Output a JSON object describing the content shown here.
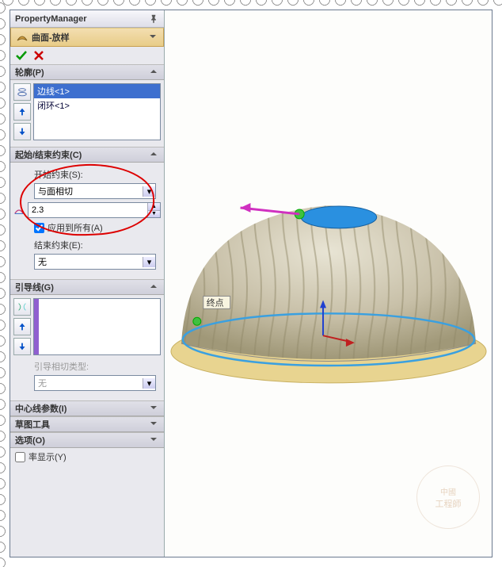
{
  "header": {
    "title": "PropertyManager"
  },
  "feature": {
    "title": "曲面-放样"
  },
  "sections": {
    "profiles": {
      "title": "轮廓(P)",
      "items": [
        "边线<1>",
        "闭环<1>"
      ]
    },
    "constraints": {
      "title": "起始/结束约束(C)",
      "start_label": "开始约束(S):",
      "start_value": "与面相切",
      "tangent_value": "2.3",
      "apply_all": "应用到所有(A)",
      "end_label": "结束约束(E):",
      "end_value": "无"
    },
    "guide": {
      "title": "引导线(G)",
      "tangent_type_label": "引导相切类型:",
      "tangent_type_value": "无"
    },
    "centerline": {
      "title": "中心线参数(I)"
    },
    "sketchtools": {
      "title": "草图工具"
    },
    "options": {
      "title": "选项(O)"
    },
    "curvature": {
      "title": "率显示(Y)"
    }
  },
  "viewport": {
    "callout": "终点"
  },
  "watermark": {
    "line1": "中國",
    "line2": "工程師"
  }
}
